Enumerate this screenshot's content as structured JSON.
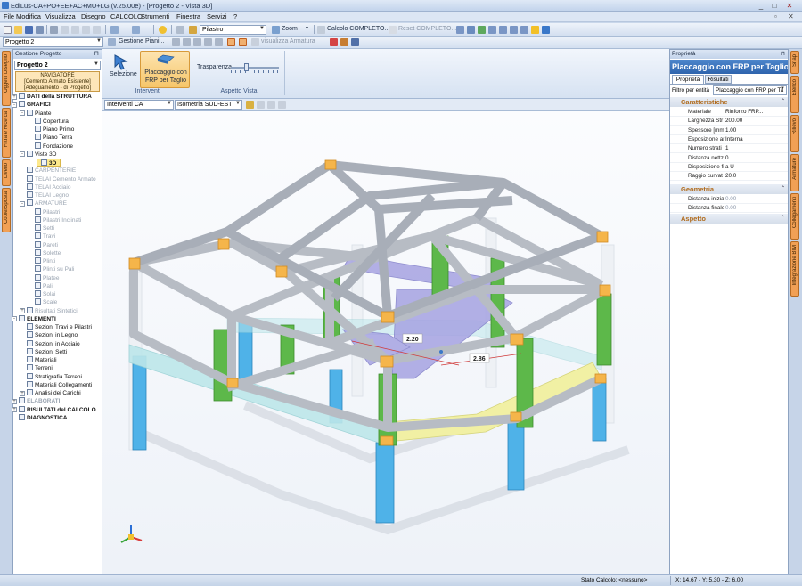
{
  "window": {
    "title": "EdiLus-CA+PO+EE+AC+MU+LG (v.25.00e) - [Progetto 2 - Vista 3D]",
    "controls": [
      "_",
      "□",
      "✕"
    ],
    "mdi_controls": [
      "_",
      "▫",
      "✕"
    ]
  },
  "menu": [
    "File",
    "Modifica",
    "Visualizza",
    "Disegno",
    "CALCOLO",
    "Strumenti",
    "Finestra",
    "Servizi",
    "?"
  ],
  "toolbar1": {
    "element_combo": "Pilastro",
    "zoom_label": "Zoom",
    "calc_label": "Calcolo COMPLETO...",
    "reset_label": "Reset COMPLETO..."
  },
  "toolbar2": {
    "project_combo": "Progetto 2",
    "manager_label": "Gestione Piani...",
    "armature_label": "visualizza Armatura"
  },
  "left_tabs": [
    "Oggetti Disegno",
    "Filtra e Ricerca",
    "Livello",
    "Copie/Sposta"
  ],
  "project_panel": {
    "header": "Gestione Progetto",
    "combo": "Progetto 2",
    "navigator": [
      "NAVIGATORE",
      "[Cemento Armato Esistente]",
      "[Adeguamento - di Progetto]"
    ],
    "tree": [
      {
        "label": "DATI della STRUTTURA",
        "level": 0,
        "exp": "+",
        "style": "normal"
      },
      {
        "label": "GRAFICI",
        "level": 0,
        "exp": "-",
        "style": "normal"
      },
      {
        "label": "Piante",
        "level": 1,
        "exp": "-",
        "style": "normal"
      },
      {
        "label": "Copertura",
        "level": 2,
        "exp": "",
        "style": "normal"
      },
      {
        "label": "Piano Primo",
        "level": 2,
        "exp": "",
        "style": "normal"
      },
      {
        "label": "Piano Terra",
        "level": 2,
        "exp": "",
        "style": "normal"
      },
      {
        "label": "Fondazione",
        "level": 2,
        "exp": "",
        "style": "normal"
      },
      {
        "label": "Viste 3D",
        "level": 1,
        "exp": "-",
        "style": "normal"
      },
      {
        "label": "3D",
        "level": 2,
        "exp": "",
        "style": "sel"
      },
      {
        "label": "CARPENTERIE",
        "level": 1,
        "exp": "",
        "style": "dim"
      },
      {
        "label": "TELAI Cemento Armato",
        "level": 1,
        "exp": "",
        "style": "dim"
      },
      {
        "label": "TELAI Acciaio",
        "level": 1,
        "exp": "",
        "style": "dim"
      },
      {
        "label": "TELAI Legno",
        "level": 1,
        "exp": "",
        "style": "dim"
      },
      {
        "label": "ARMATURE",
        "level": 1,
        "exp": "-",
        "style": "dim"
      },
      {
        "label": "Pilastri",
        "level": 2,
        "exp": "",
        "style": "dim"
      },
      {
        "label": "Pilastri Inclinati",
        "level": 2,
        "exp": "",
        "style": "dim"
      },
      {
        "label": "Setti",
        "level": 2,
        "exp": "",
        "style": "dim"
      },
      {
        "label": "Travi",
        "level": 2,
        "exp": "",
        "style": "dim"
      },
      {
        "label": "Pareti",
        "level": 2,
        "exp": "",
        "style": "dim"
      },
      {
        "label": "Solette",
        "level": 2,
        "exp": "",
        "style": "dim"
      },
      {
        "label": "Plinti",
        "level": 2,
        "exp": "",
        "style": "dim"
      },
      {
        "label": "Plinti su Pali",
        "level": 2,
        "exp": "",
        "style": "dim"
      },
      {
        "label": "Platee",
        "level": 2,
        "exp": "",
        "style": "dim"
      },
      {
        "label": "Pali",
        "level": 2,
        "exp": "",
        "style": "dim"
      },
      {
        "label": "Solai",
        "level": 2,
        "exp": "",
        "style": "dim"
      },
      {
        "label": "Scale",
        "level": 2,
        "exp": "",
        "style": "dim"
      },
      {
        "label": "Risultati Sintetici",
        "level": 1,
        "exp": "+",
        "style": "dim"
      },
      {
        "label": "ELEMENTI",
        "level": 0,
        "exp": "-",
        "style": "normal"
      },
      {
        "label": "Sezioni Travi e Pilastri",
        "level": 1,
        "exp": "",
        "style": "normal"
      },
      {
        "label": "Sezioni in Legno",
        "level": 1,
        "exp": "",
        "style": "normal"
      },
      {
        "label": "Sezioni in Acciaio",
        "level": 1,
        "exp": "",
        "style": "normal"
      },
      {
        "label": "Sezioni Setti",
        "level": 1,
        "exp": "",
        "style": "normal"
      },
      {
        "label": "Materiali",
        "level": 1,
        "exp": "",
        "style": "normal"
      },
      {
        "label": "Terreni",
        "level": 1,
        "exp": "",
        "style": "normal"
      },
      {
        "label": "Stratigrafia Terreni",
        "level": 1,
        "exp": "",
        "style": "normal"
      },
      {
        "label": "Materiali Collegamenti",
        "level": 1,
        "exp": "",
        "style": "normal"
      },
      {
        "label": "Analisi dei Carichi",
        "level": 1,
        "exp": "+",
        "style": "normal"
      },
      {
        "label": "ELABORATI",
        "level": 0,
        "exp": "+",
        "style": "dim"
      },
      {
        "label": "RISULTATI del CALCOLO",
        "level": 0,
        "exp": "+",
        "style": "normal"
      },
      {
        "label": "DIAGNOSTICA",
        "level": 0,
        "exp": "",
        "style": "normal"
      }
    ]
  },
  "ribbon": {
    "selezione": "Selezione",
    "placcaggio_line1": "Placcaggio con",
    "placcaggio_line2": "FRP per Taglio",
    "trasparenza": "Trasparenza",
    "transparency_level": 0.3,
    "group_interventi": "Interventi",
    "group_aspetto": "Aspetto Vista"
  },
  "viewport_bar": {
    "mode_combo": "Interventi CA",
    "view_combo": "Isometria SUD-EST"
  },
  "dimensions": [
    "2.20",
    "2.86"
  ],
  "properties": {
    "header": "Proprietà",
    "title": "Placcaggio con FRP per Taglio",
    "tabs": [
      "Proprietà",
      "Risultati"
    ],
    "filter_label": "Filtro per entità",
    "filter_combo": "Placcaggio con FRP per Ta",
    "section_char": "Caratteristiche",
    "rows": [
      {
        "key": "Materiale",
        "value": "Rinforzo FRP..."
      },
      {
        "key": "Larghezza Str",
        "value": "200.00"
      },
      {
        "key": "Spessore [mm",
        "value": "1.00"
      },
      {
        "key": "Esposizione ar",
        "value": "Interna"
      },
      {
        "key": "Numero strati",
        "value": "1"
      },
      {
        "key": "Distanza nettz",
        "value": "0"
      },
      {
        "key": "Disposizione fi",
        "value": "a U"
      },
      {
        "key": "Raggio curvat",
        "value": "20.0"
      }
    ],
    "section_geom": "Geometria",
    "geom_rows": [
      {
        "key": "Distanza inizia",
        "value": "0.00"
      },
      {
        "key": "Distanza finale",
        "value": "0.00"
      }
    ],
    "section_aspetto": "Aspetto"
  },
  "right_tabs": [
    "Snap",
    "Elenco",
    "Rilievo",
    "Armature",
    "Collegamenti",
    "Integrazione BIM"
  ],
  "status": {
    "calc": "Stato Calcolo: <nessuno>",
    "coords": "X: 14.67 - Y: 5.30 - Z: 6.00"
  },
  "colors": {
    "beam": "#b7bcc4",
    "column_green": "#5db84a",
    "column_blue": "#4fb2e8",
    "node_orange": "#f5b54a",
    "stair": "#a6a3e2",
    "frp_yellow": "#f1f0a4",
    "frp_cyan": "#bde7ea",
    "accent_title": "#1f5fa8"
  }
}
